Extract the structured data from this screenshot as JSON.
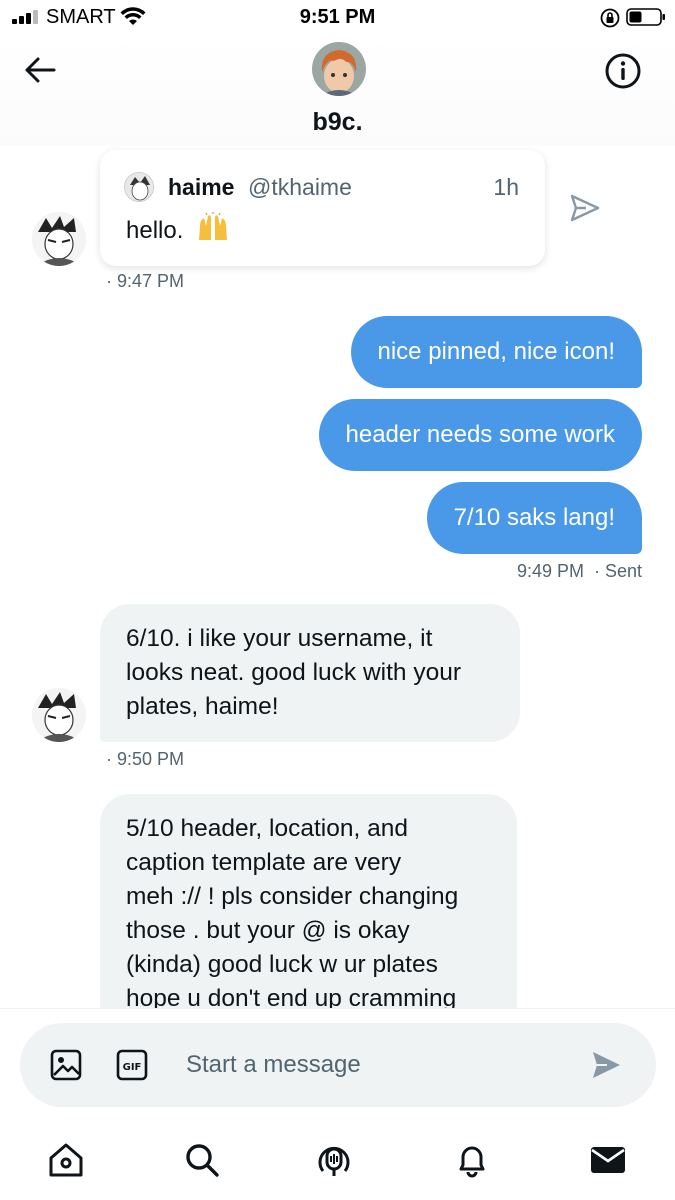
{
  "status_bar": {
    "carrier": "SMART",
    "time": "9:51 PM"
  },
  "header": {
    "name": "b9c."
  },
  "messages": {
    "quoted_tweet": {
      "name": "haime",
      "handle": "@tkhaime",
      "age": "1h",
      "text": "hello.",
      "timestamp": "· 9:47 PM"
    },
    "outgoing": [
      {
        "text": "nice pinned, nice icon!"
      },
      {
        "text": "header needs some work"
      },
      {
        "text": "7/10 saks lang!"
      }
    ],
    "outgoing_meta": "9:49 PM  · Sent",
    "incoming_1": {
      "lines": [
        "6/10. i like your username, it",
        "looks neat. good luck with your",
        "plates, haime!"
      ],
      "timestamp": "· 9:50 PM"
    },
    "incoming_2": {
      "lines": [
        "5/10 header, location, and",
        "caption template are very",
        "meh :// ! pls consider changing",
        "those . but your @ is okay",
        "(kinda) good luck w ur plates",
        "hope u don't end up cramming"
      ]
    }
  },
  "composer": {
    "placeholder": "Start a message"
  },
  "colors": {
    "accent": "#4a99e9",
    "incoming_bubble": "#eff3f4",
    "secondary_text": "#536471"
  },
  "icons": {
    "nav": [
      "home-icon",
      "search-icon",
      "spaces-icon",
      "notifications-icon",
      "messages-icon"
    ]
  }
}
